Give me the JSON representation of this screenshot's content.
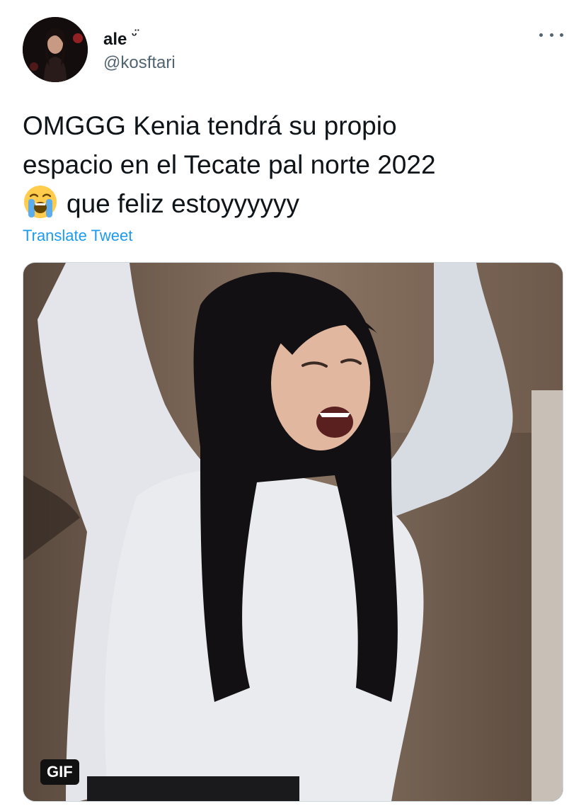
{
  "user": {
    "display_name": "ale",
    "display_name_emoji": "ᵕ̈",
    "handle": "@kosftari",
    "avatar_icon": "profile-photo"
  },
  "menu": {
    "icon": "more-options-icon"
  },
  "tweet": {
    "line1": "OMGGG Kenia tendrá su propio",
    "line2": "espacio en el Tecate pal norte 2022",
    "emoji": "loudly-crying-face",
    "line3": "que feliz estoyyyyyy"
  },
  "translate_label": "Translate Tweet",
  "media": {
    "type": "gif",
    "badge": "GIF"
  },
  "colors": {
    "link": "#1d9bf0",
    "secondary_text": "#536471",
    "primary_text": "#0f1419"
  }
}
